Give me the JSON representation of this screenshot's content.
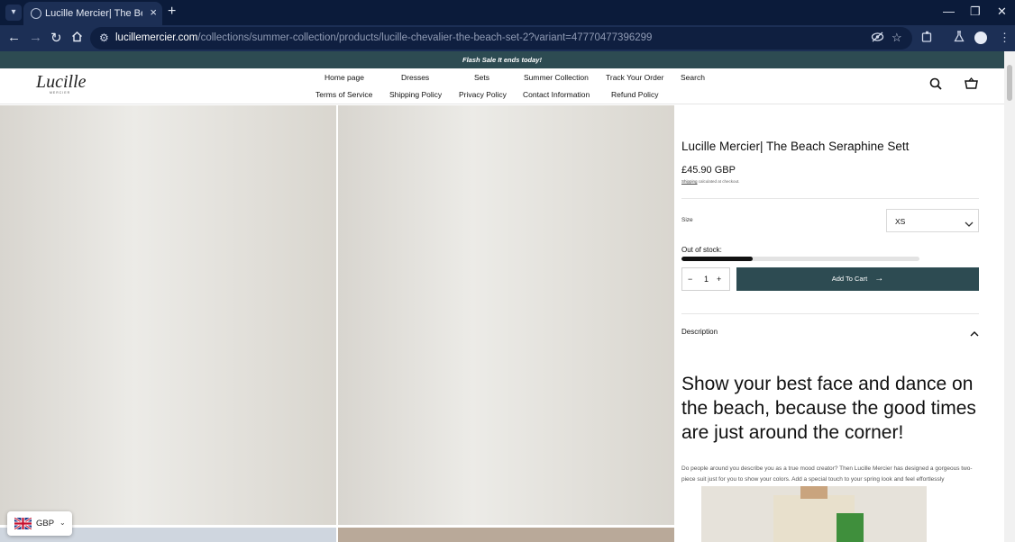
{
  "browser": {
    "tab_title": "Lucille Mercier| The Beach Seraphine Sett",
    "url_host": "lucillemercier.com",
    "url_path": "/collections/summer-collection/products/lucille-chevalier-the-beach-set-2?variant=47770477396299"
  },
  "announcement": "Flash Sale It ends today!",
  "logo": {
    "name": "Lucille",
    "sub": "MERCIER"
  },
  "nav": {
    "row1": [
      "Home page",
      "Dresses",
      "Sets",
      "Summer Collection",
      "Track Your Order",
      "Search"
    ],
    "row2": [
      "Terms of Service",
      "Shipping Policy",
      "Privacy Policy",
      "Contact Information",
      "Refund Policy"
    ]
  },
  "product": {
    "title": "Lucille Mercier| The Beach Seraphine Sett",
    "price": "£45.90 GBP",
    "shipping_link": "Shipping",
    "shipping_text": " calculated at checkout.",
    "size_label": "Size",
    "size_value": "XS",
    "stock_label": "Out of stock:",
    "stock_level": 0.3,
    "qty_minus": "−",
    "quantity": "1",
    "qty_plus": "+",
    "add_to_cart": "Add To Cart",
    "description_label": "Description",
    "headline": "Show your best face and dance on the beach, because the good times are just around the corner!",
    "paragraph": "Do people around you describe you as a true mood creator? Then Lucille Mercier has designed a gorgeous two-piece suit just for you to show your colors. Add a special touch to your spring look and feel effortlessly"
  },
  "currency": {
    "code": "GBP"
  },
  "colors": {
    "brand": "#2d4b52",
    "chrome_dark": "#0b1b3a",
    "chrome": "#1c2f55"
  },
  "icons": [
    "tab-menu-icon",
    "favicon-icon",
    "close-icon",
    "plus-icon",
    "back-icon",
    "forward-icon",
    "reload-icon",
    "home-icon",
    "site-info-icon",
    "eye-off-icon",
    "star-icon",
    "extensions-icon",
    "labs-icon",
    "profile-icon",
    "kebab-menu-icon",
    "search-icon",
    "cart-icon",
    "chevron-down-icon",
    "chevron-up-icon",
    "arrow-right-icon",
    "uk-flag-icon"
  ]
}
